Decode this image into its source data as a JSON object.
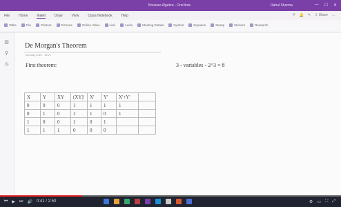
{
  "window": {
    "title": "Boolean Algebra - OneNote",
    "user": "Rahul Sharma",
    "controls": [
      "—",
      "☐",
      "✕"
    ]
  },
  "menu": {
    "tabs": [
      "File",
      "Home",
      "Insert",
      "Draw",
      "View",
      "Class Notebook",
      "Help"
    ],
    "active_tab": "Insert",
    "right_tools": [
      "⚲",
      "🔔",
      "✎",
      "⇪ Share",
      "…"
    ]
  },
  "ribbon": {
    "items": [
      "Table",
      "File",
      "Printout",
      "Pictures",
      "Online Video",
      "Link",
      "Audio",
      "Meeting Details",
      "Symbol",
      "Equation",
      "Stamp",
      "Stickers",
      "Research"
    ]
  },
  "leftrail": {
    "icons": [
      "notebook-icon",
      "search-icon",
      "history-icon"
    ]
  },
  "note": {
    "title": "De Morgan's Theorem",
    "date": "Tuesday 2021",
    "time": "18:21",
    "first_theorem": "First theorem:",
    "variables_note": "3 - variables - 2^3 = 8"
  },
  "truth_table": {
    "headers": [
      "X",
      "Y",
      "XY",
      "(XY)'",
      "X'",
      "Y'",
      "X'+Y'",
      ""
    ],
    "rows": [
      [
        "0",
        "0",
        "0",
        "1",
        "1",
        "1",
        "1",
        ""
      ],
      [
        "0",
        "1",
        "0",
        "1",
        "1",
        "0",
        "1",
        ""
      ],
      [
        "1",
        "0",
        "0",
        "1",
        "0",
        "1",
        "",
        ""
      ],
      [
        "1",
        "1",
        "1",
        "0",
        "0",
        "0",
        "",
        ""
      ]
    ]
  },
  "player": {
    "progress": 0.24,
    "time_label": "0:41 / 2:50",
    "controls": [
      "⏮",
      "▶",
      "⏭",
      "🔊"
    ]
  },
  "taskbar": {
    "app_colors": [
      "#3b78d8",
      "#e8a23a",
      "#3aa76d",
      "#b84040",
      "#7b3fa8",
      "#1c8fd6",
      "#c8c8c8",
      "#d65a2f",
      "#4d6fd1"
    ],
    "tray": [
      "⚙",
      "▭",
      "⛶",
      "⤢"
    ]
  }
}
